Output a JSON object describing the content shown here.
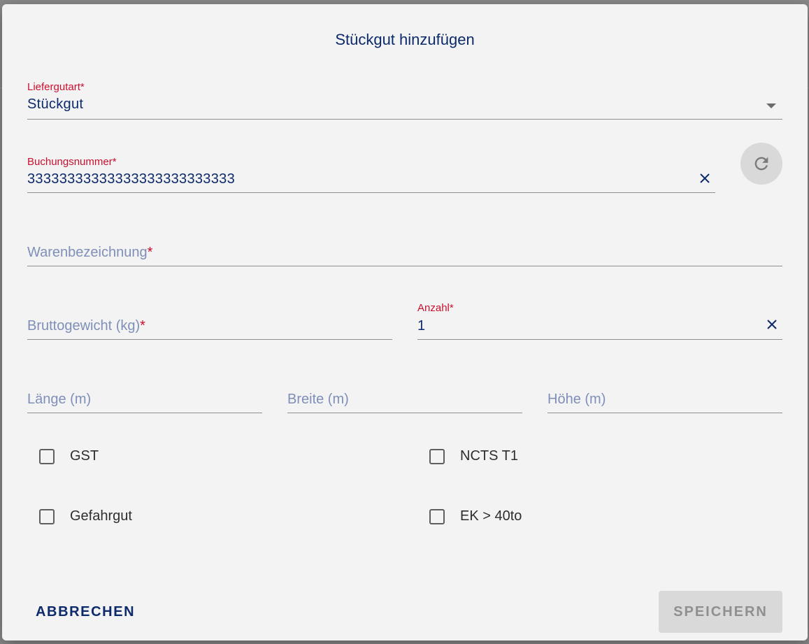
{
  "dialog": {
    "title": "Stückgut hinzufügen"
  },
  "lieferguart": {
    "label": "Liefergutart",
    "required_mark": "*",
    "value": "Stückgut"
  },
  "buchungsnummer": {
    "label": "Buchungsnummer",
    "required_mark": "*",
    "value": "33333333333333333333333333"
  },
  "warenbezeichnung": {
    "placeholder": "Warenbezeichnung",
    "required_mark": "*"
  },
  "bruttogewicht": {
    "placeholder": "Bruttogewicht (kg)",
    "required_mark": "*"
  },
  "anzahl": {
    "label": "Anzahl",
    "required_mark": "*",
    "value": "1"
  },
  "dimensions": {
    "laenge": "Länge (m)",
    "breite": "Breite (m)",
    "hoehe": "Höhe (m)"
  },
  "checkboxes": {
    "gst": "GST",
    "ncts": "NCTS T1",
    "gefahrgut": "Gefahrgut",
    "ek": "EK > 40to"
  },
  "actions": {
    "cancel": "ABBRECHEN",
    "save": "SPEICHERN"
  },
  "colors": {
    "primary": "#0d2a6b",
    "required": "#c8102e",
    "placeholder": "#7f8fb7",
    "dialog_bg": "#f3f3f3",
    "disabled_btn": "#d9d9d9"
  }
}
